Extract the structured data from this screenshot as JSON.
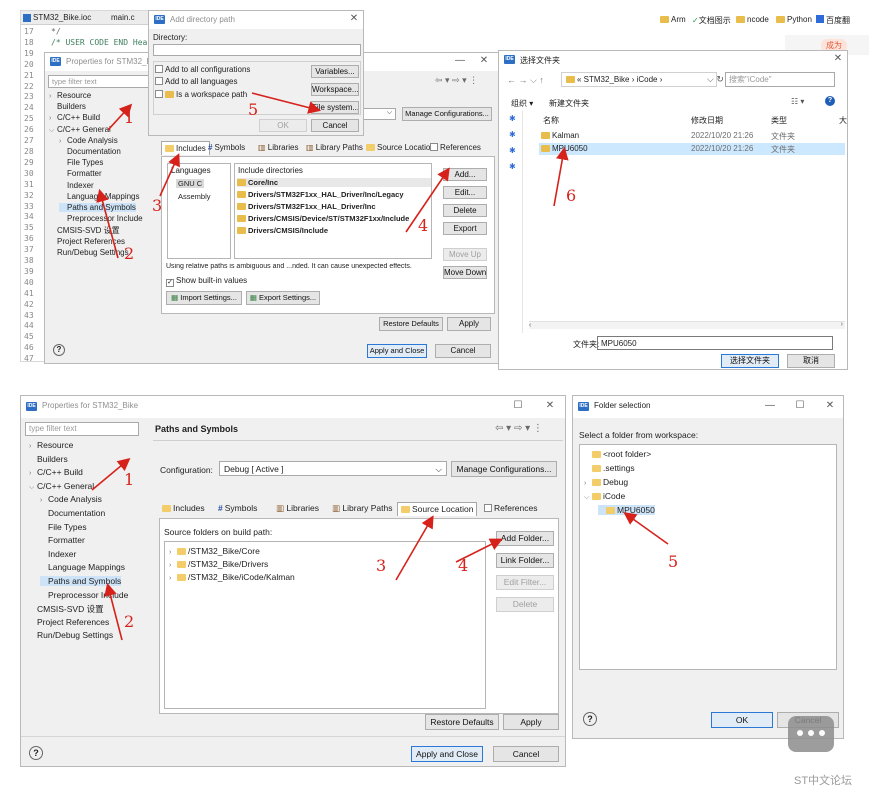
{
  "top_editor": {
    "tab1": "STM32_Bike.ioc",
    "tab2": "main.c",
    "line_numbers": [
      "17",
      "18",
      "19",
      "20",
      "21",
      "22",
      "23",
      "24",
      "25",
      "26",
      "27",
      "28",
      "29",
      "30",
      "31",
      "32",
      "33",
      "34",
      "35",
      "36",
      "37",
      "38",
      "39",
      "40",
      "41",
      "42",
      "43",
      "44",
      "45",
      "46",
      "47"
    ],
    "code_line1": "*/",
    "code_line2": "/* USER CODE END Hea",
    "bookmarks": [
      "Arm",
      "文档图示",
      "ncode",
      "Python",
      "百度翻"
    ],
    "far_right_tab": "成为"
  },
  "add_dir_dialog": {
    "title": "Add directory path",
    "directory_label": "Directory:",
    "opt_all_configs": "Add to all configurations",
    "opt_all_langs": "Add to all languages",
    "opt_workspace": "Is a workspace path",
    "btn_variables": "Variables...",
    "btn_workspace": "Workspace...",
    "btn_filesystem": "File system...",
    "btn_ok": "OK",
    "btn_cancel": "Cancel"
  },
  "props_top": {
    "title": "Properties for STM32_Bike",
    "filter_placeholder": "type filter text",
    "tree": [
      {
        "chev": ">",
        "label": "Resource",
        "indent": 0
      },
      {
        "chev": "",
        "label": "Builders",
        "indent": 0
      },
      {
        "chev": ">",
        "label": "C/C++ Build",
        "indent": 0
      },
      {
        "chev": "v",
        "label": "C/C++ General",
        "indent": 0
      },
      {
        "chev": ">",
        "label": "Code Analysis",
        "indent": 1
      },
      {
        "chev": "",
        "label": "Documentation",
        "indent": 1
      },
      {
        "chev": "",
        "label": "File Types",
        "indent": 1
      },
      {
        "chev": "",
        "label": "Formatter",
        "indent": 1
      },
      {
        "chev": "",
        "label": "Indexer",
        "indent": 1
      },
      {
        "chev": "",
        "label": "Language Mappings",
        "indent": 1
      },
      {
        "chev": "",
        "label": "Paths and Symbols",
        "indent": 1
      },
      {
        "chev": "",
        "label": "Preprocessor Include",
        "indent": 1
      },
      {
        "chev": "",
        "label": "CMSIS-SVD 设置",
        "indent": 0
      },
      {
        "chev": "",
        "label": "Project References",
        "indent": 0
      },
      {
        "chev": "",
        "label": "Run/Debug Settings",
        "indent": 0
      }
    ],
    "btn_manage_configs": "Manage Configurations...",
    "tabs": [
      "Includes",
      "Symbols",
      "Libraries",
      "Library Paths",
      "Source Location",
      "References"
    ],
    "languages_header": "Languages",
    "languages": [
      "GNU C",
      "Assembly"
    ],
    "include_header": "Include directories",
    "includes": [
      "Core/Inc",
      "Drivers/STM32F1xx_HAL_Driver/Inc/Legacy",
      "Drivers/STM32F1xx_HAL_Driver/Inc",
      "Drivers/CMSIS/Device/ST/STM32F1xx/Include",
      "Drivers/CMSIS/Include"
    ],
    "btn_add": "Add...",
    "btn_edit": "Edit...",
    "btn_delete": "Delete",
    "btn_export": "Export",
    "btn_move_up": "Move Up",
    "btn_move_down": "Move Down",
    "warning": "Using relative paths is ambiguous and ...nded. It can cause unexpected effects.",
    "show_builtin": "Show built-in values",
    "btn_import_settings": "Import Settings...",
    "btn_export_settings": "Export Settings...",
    "btn_restore": "Restore Defaults",
    "btn_apply": "Apply",
    "btn_apply_close": "Apply and Close",
    "btn_cancel": "Cancel",
    "help": "?"
  },
  "file_chooser": {
    "title": "选择文件夹",
    "path": [
      "« STM32_Bike",
      "iCode"
    ],
    "search_placeholder": "搜索\"iCode\"",
    "btn_organize": "组织 ▾",
    "btn_new_folder": "新建文件夹",
    "col_name": "名称",
    "col_date": "修改日期",
    "col_type": "类型",
    "col_size": "大",
    "rows": [
      {
        "name": "Kalman",
        "date": "2022/10/20 21:26",
        "type": "文件夹"
      },
      {
        "name": "MPU6050",
        "date": "2022/10/20 21:26",
        "type": "文件夹"
      }
    ],
    "folder_label": "文件夹:",
    "folder_value": "MPU6050",
    "btn_select": "选择文件夹",
    "btn_cancel": "取消"
  },
  "props_bottom": {
    "title": "Properties for STM32_Bike",
    "filter_placeholder": "type filter text",
    "tree": [
      {
        "chev": ">",
        "label": "Resource",
        "indent": 0
      },
      {
        "chev": "",
        "label": "Builders",
        "indent": 0
      },
      {
        "chev": ">",
        "label": "C/C++ Build",
        "indent": 0
      },
      {
        "chev": "v",
        "label": "C/C++ General",
        "indent": 0
      },
      {
        "chev": ">",
        "label": "Code Analysis",
        "indent": 1
      },
      {
        "chev": "",
        "label": "Documentation",
        "indent": 1
      },
      {
        "chev": "",
        "label": "File Types",
        "indent": 1
      },
      {
        "chev": "",
        "label": "Formatter",
        "indent": 1
      },
      {
        "chev": "",
        "label": "Indexer",
        "indent": 1
      },
      {
        "chev": "",
        "label": "Language Mappings",
        "indent": 1
      },
      {
        "chev": "",
        "label": "Paths and Symbols",
        "indent": 1
      },
      {
        "chev": "",
        "label": "Preprocessor Include",
        "indent": 1
      },
      {
        "chev": "",
        "label": "CMSIS-SVD 设置",
        "indent": 0
      },
      {
        "chev": "",
        "label": "Project References",
        "indent": 0
      },
      {
        "chev": "",
        "label": "Run/Debug Settings",
        "indent": 0
      }
    ],
    "page_title": "Paths and Symbols",
    "config_label": "Configuration:",
    "config_value": "Debug  [ Active ]",
    "btn_manage_configs": "Manage Configurations...",
    "tabs": [
      "Includes",
      "Symbols",
      "Libraries",
      "Library Paths",
      "Source Location",
      "References"
    ],
    "source_label": "Source folders on build path:",
    "sources": [
      "/STM32_Bike/Core",
      "/STM32_Bike/Drivers",
      "/STM32_Bike/iCode/Kalman"
    ],
    "btn_add_folder": "Add Folder...",
    "btn_link_folder": "Link Folder...",
    "btn_edit_filter": "Edit Filter...",
    "btn_delete": "Delete",
    "btn_restore": "Restore Defaults",
    "btn_apply": "Apply",
    "btn_apply_close": "Apply and Close",
    "btn_cancel": "Cancel",
    "help": "?"
  },
  "folder_selection": {
    "title": "Folder selection",
    "prompt": "Select a folder from workspace:",
    "tree": [
      {
        "chev": "",
        "label": "<root folder>",
        "indent": 0
      },
      {
        "chev": "",
        "label": ".settings",
        "indent": 0
      },
      {
        "chev": ">",
        "label": "Debug",
        "indent": 0
      },
      {
        "chev": "v",
        "label": "iCode",
        "indent": 0
      },
      {
        "chev": "",
        "label": "MPU6050",
        "indent": 1
      }
    ],
    "btn_ok": "OK",
    "btn_cancel": "Cancel",
    "help": "?"
  },
  "annotations": {
    "top": [
      "1",
      "2",
      "3",
      "4",
      "5",
      "6"
    ],
    "bottom": [
      "1",
      "2",
      "3",
      "4",
      "5"
    ]
  },
  "watermark": "ST中文论坛",
  "colors": {
    "annotation_red": "#d6221b",
    "selection_blue": "#cde3f7",
    "primary_border": "#2b79d6",
    "ide_icon": "#2c6fc4",
    "folder_yellow": "#e9bd4c"
  }
}
